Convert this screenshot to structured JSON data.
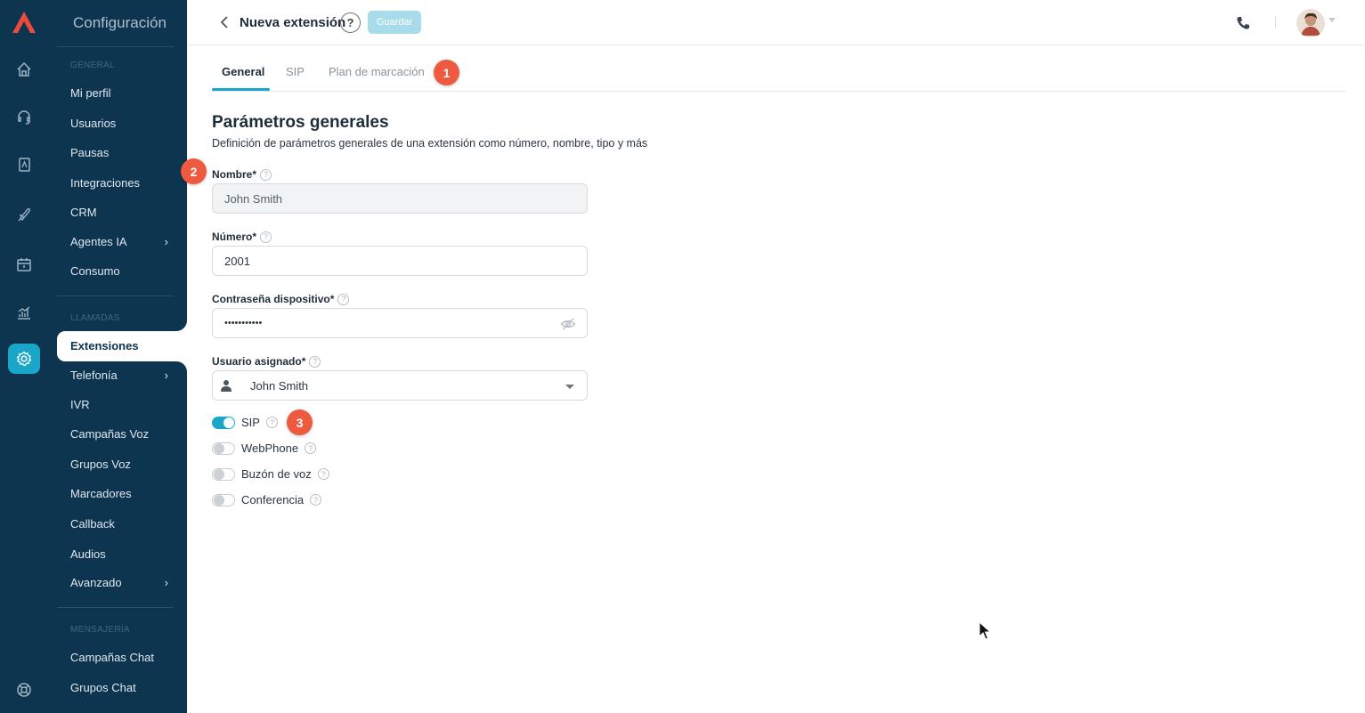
{
  "nav": {
    "title": "Configuración",
    "sections": {
      "general": "GENERAL",
      "llamadas": "LLAMADAS",
      "mensajeria": "MENSAJERÍA"
    },
    "items": [
      {
        "label": "Mi perfil"
      },
      {
        "label": "Usuarios"
      },
      {
        "label": "Pausas"
      },
      {
        "label": "Integraciones"
      },
      {
        "label": "CRM"
      },
      {
        "label": "Agentes IA",
        "chevron": "›"
      },
      {
        "label": "Consumo"
      },
      {
        "label": "Extensiones",
        "active": true
      },
      {
        "label": "Telefonía",
        "chevron": "›"
      },
      {
        "label": "IVR"
      },
      {
        "label": "Campañas Voz"
      },
      {
        "label": "Grupos Voz"
      },
      {
        "label": "Marcadores"
      },
      {
        "label": "Callback"
      },
      {
        "label": "Audios"
      },
      {
        "label": "Avanzado",
        "chevron": "›"
      },
      {
        "label": "Campañas Chat"
      },
      {
        "label": "Grupos Chat"
      }
    ]
  },
  "rail": {
    "icons": [
      "logo-icon",
      "home-icon",
      "headset-icon",
      "contacts-book-icon",
      "rocket-icon",
      "calendar-icon",
      "analytics-icon",
      "settings-icon",
      "support-lifebuoy-icon"
    ],
    "active": "settings-icon",
    "accent": "#1aa6c9",
    "background": "#0d3550"
  },
  "header": {
    "title": "Nueva extensión",
    "help": "?",
    "save_label": "Guardar"
  },
  "tabs": [
    {
      "label": "General",
      "active": true
    },
    {
      "label": "SIP"
    },
    {
      "label": "Plan de marcación"
    }
  ],
  "badges": [
    "1",
    "2",
    "3"
  ],
  "form": {
    "section_title": "Parámetros generales",
    "section_desc": "Definición de parámetros generales de una extensión como número, nombre, tipo y más",
    "name_label": "Nombre*",
    "name_value": "John Smith",
    "number_label": "Número*",
    "number_value": "2001",
    "password_label": "Contraseña dispositivo*",
    "password_value": "•••••••••••",
    "user_label": "Usuario asignado*",
    "user_value": "John Smith",
    "toggles": [
      {
        "label": "SIP",
        "on": true
      },
      {
        "label": "WebPhone",
        "on": false
      },
      {
        "label": "Buzón de voz",
        "on": false
      },
      {
        "label": "Conferencia",
        "on": false
      }
    ]
  },
  "colors": {
    "badge": "#ee5a3f",
    "save_button": "#a9dcea"
  }
}
